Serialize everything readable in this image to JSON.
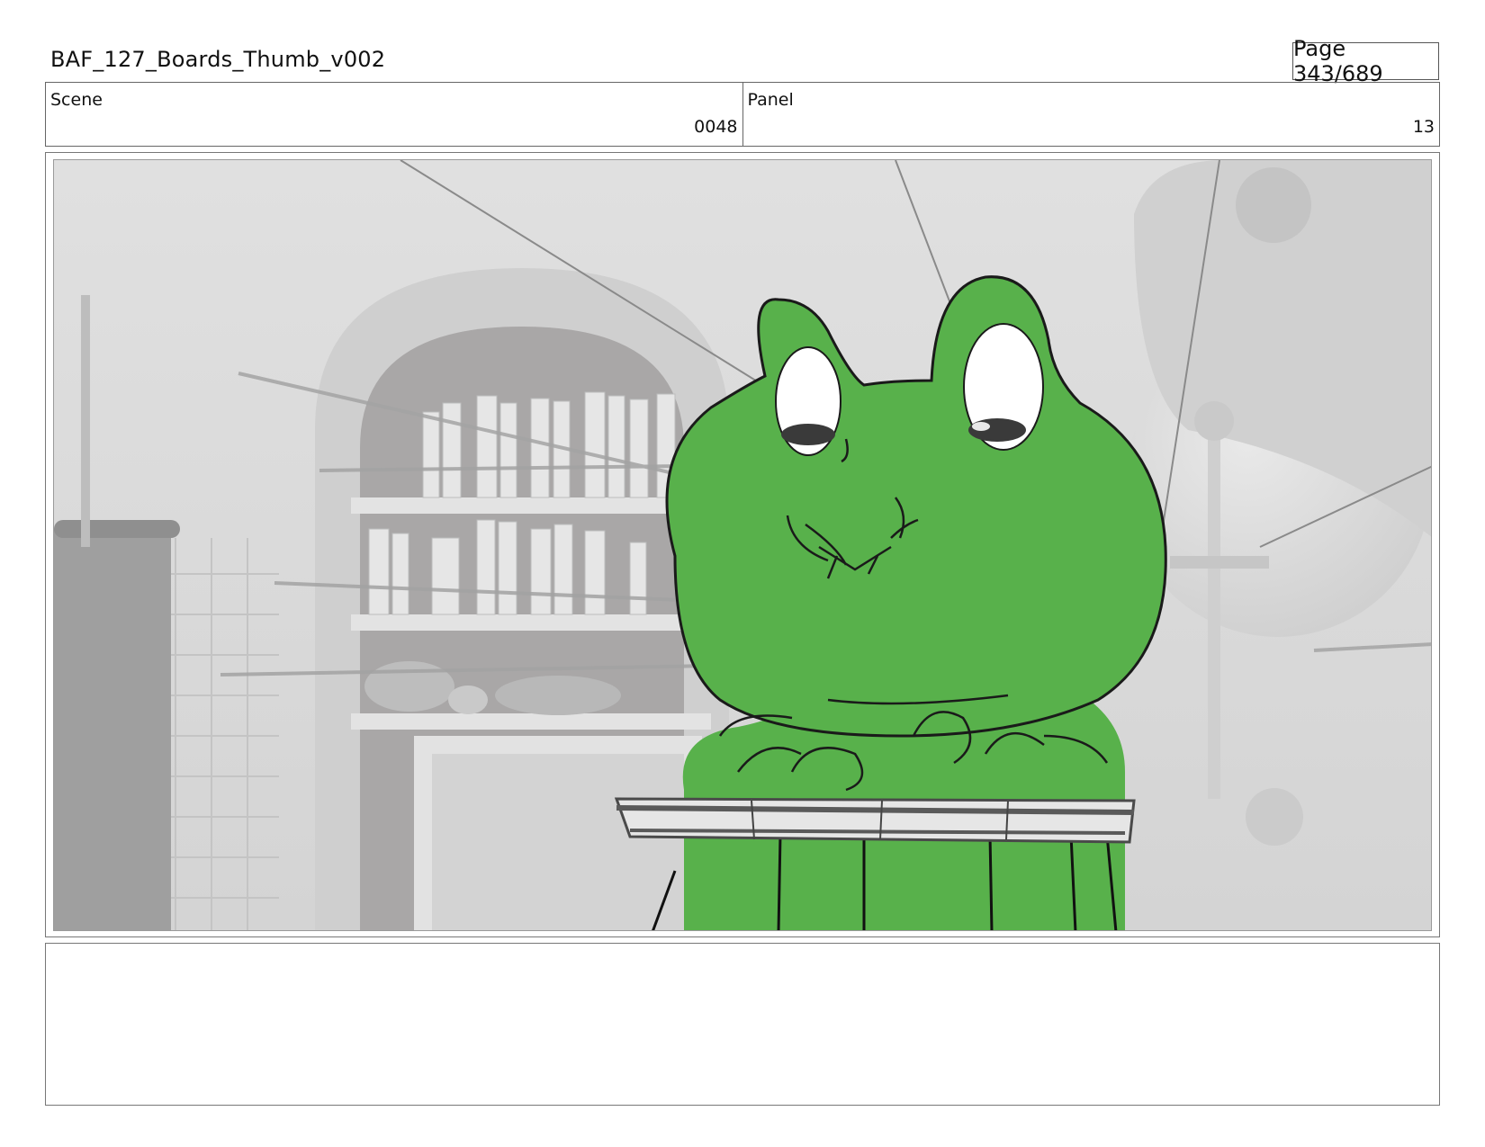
{
  "header": {
    "title": "BAF_127_Boards_Thumb_v002",
    "page": "Page 343/689"
  },
  "info": {
    "scene_label": "Scene",
    "scene_value": "0048",
    "panel_label": "Panel",
    "panel_value": "13"
  },
  "panel": {
    "description_icon": "frog-character-sketch",
    "colors": {
      "frog_green": "#58b14b",
      "background_gray": "#d9d9d9",
      "outline": "#1a1a1a"
    }
  },
  "notes": {
    "text": ""
  }
}
